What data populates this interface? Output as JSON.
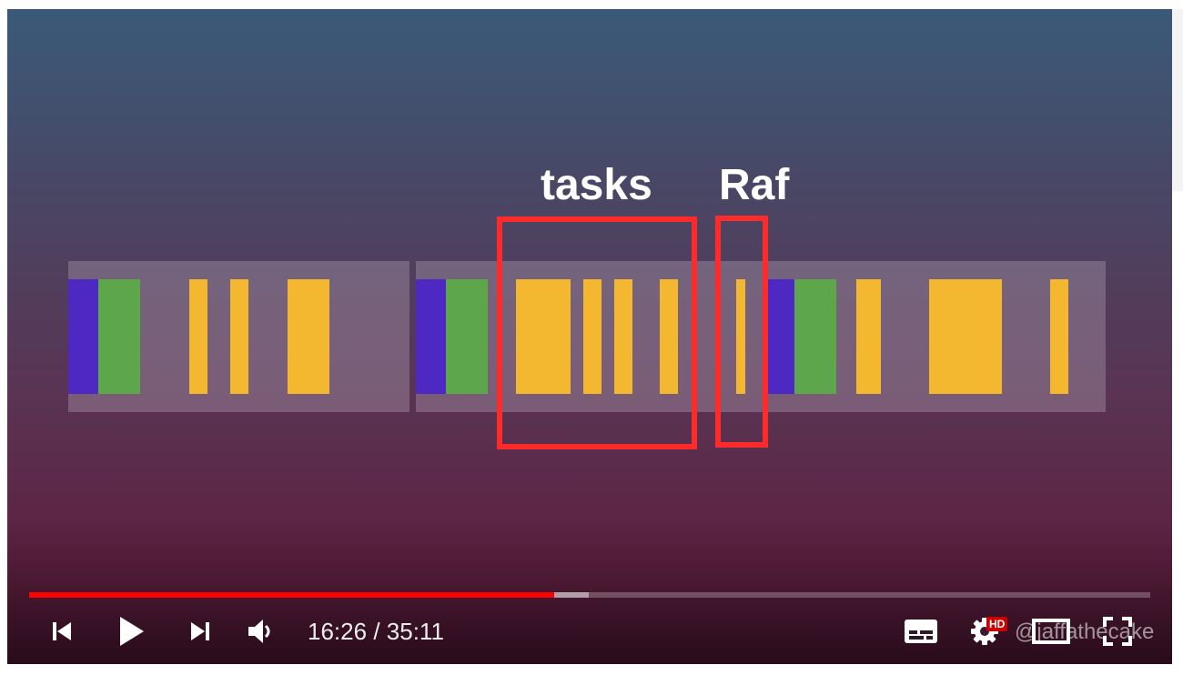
{
  "slide": {
    "labels": {
      "tasks": "tasks",
      "raf": "Raf"
    },
    "colors": {
      "style_recalc": "#4e28c2",
      "layout": "#5ea64b",
      "task": "#f4b830",
      "highlight": "#ff2a2a"
    }
  },
  "player": {
    "played_fraction": 0.468,
    "buffered_fraction": 0.499,
    "time_current": "16:26",
    "time_separator": "/",
    "time_total": "35:11",
    "hd_badge": "HD",
    "watermark": "@jaffathecake",
    "colors": {
      "progress": "#ff0000"
    },
    "icons": [
      "previous-icon",
      "play-icon",
      "next-icon",
      "volume-icon",
      "captions-icon",
      "settings-icon",
      "theater-icon",
      "fullscreen-icon"
    ]
  }
}
